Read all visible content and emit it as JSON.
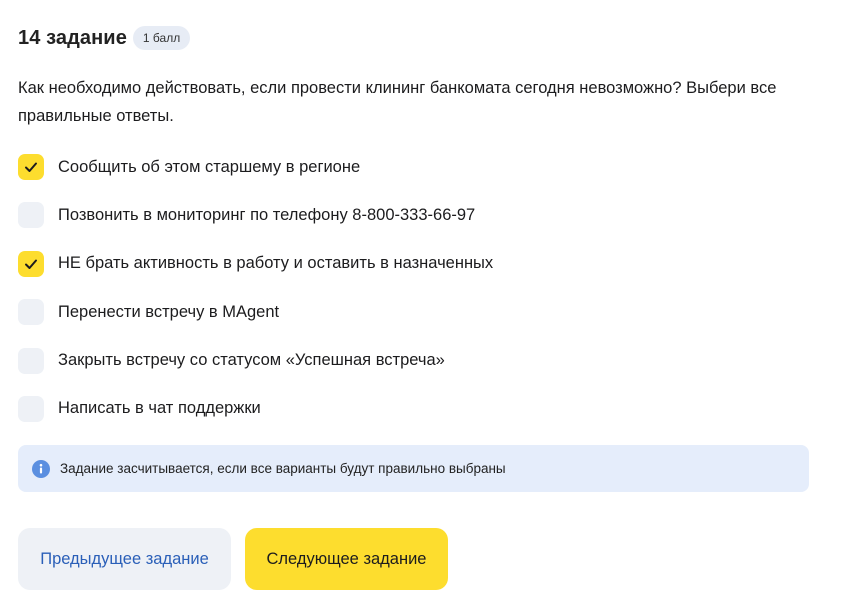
{
  "task": {
    "title": "14 задание",
    "points": "1 балл",
    "question": "Как необходимо действовать, если провести клининг банкомата сегодня невозможно? Выбери все правильные ответы."
  },
  "options": [
    {
      "label": "Сообщить об этом старшему в регионе",
      "checked": true
    },
    {
      "label": "Позвонить в мониторинг по телефону 8-800-333-66-97",
      "checked": false
    },
    {
      "label": "НЕ брать активность в работу и оставить в назначенных",
      "checked": true
    },
    {
      "label": "Перенести встречу в MAgent",
      "checked": false
    },
    {
      "label": "Закрыть встречу со статусом «Успешная встреча»",
      "checked": false
    },
    {
      "label": "Написать в чат поддержки",
      "checked": false
    }
  ],
  "info": {
    "icon": "info-icon",
    "text": "Задание засчитывается, если все варианты будут правильно выбраны"
  },
  "buttons": {
    "prev_label": "Предыдущее задание",
    "next_label": "Следующее задание"
  },
  "colors": {
    "accent_yellow": "#fddd2e",
    "checkbox_empty": "#eef1f6",
    "info_bg": "#e5edfb",
    "link_blue": "#2a5fb8"
  }
}
